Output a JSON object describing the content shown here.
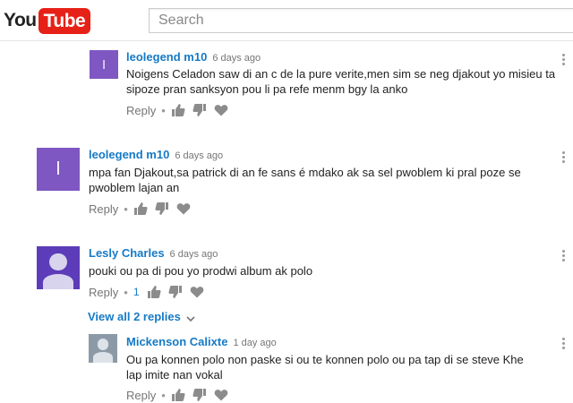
{
  "header": {
    "logo_you": "You",
    "logo_tube": "Tube",
    "search_placeholder": "Search"
  },
  "comments": [
    {
      "author": "leolegend m10",
      "time": "6 days ago",
      "avatar_letter": "l",
      "text": "Noigens Celadon  saw di an c de la pure verite,men sim se neg djakout yo misieu ta sipoze pran sanksyon pou li pa refe menm bgy la anko",
      "reply_label": "Reply"
    },
    {
      "author": "leolegend m10",
      "time": "6 days ago",
      "avatar_letter": "l",
      "text": "mpa fan Djakout,sa patrick di an fe sans é mdako ak sa sel pwoblem ki pral poze se pwoblem lajan an",
      "reply_label": "Reply"
    },
    {
      "author": "Lesly Charles",
      "time": "6 days ago",
      "text": "pouki ou pa di pou yo prodwi album ak polo",
      "reply_label": "Reply",
      "like_count": "1"
    },
    {
      "author": "Mickenson Calixte",
      "time": "1 day ago",
      "text": "Ou pa konnen polo non paske si ou te konnen polo ou pa tap di se steve Khe lap imite nan vokal",
      "reply_label": "Reply"
    }
  ],
  "view_replies_label": "View all 2 replies",
  "colors": {
    "link_blue": "#167ac6",
    "youtube_red": "#e62117",
    "avatar_purple": "#7e57c2"
  }
}
